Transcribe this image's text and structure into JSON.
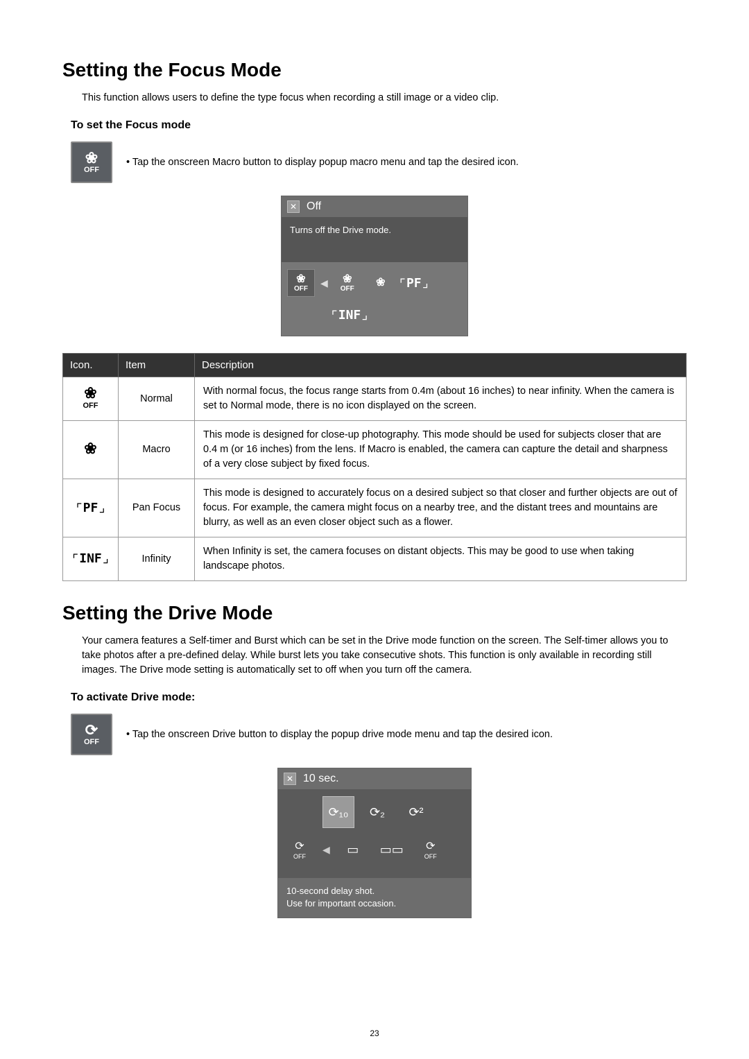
{
  "page_number": "23",
  "section1": {
    "heading": "Setting the Focus Mode",
    "intro": "This function allows users to define the type focus when recording a still image or a video clip.",
    "sub": "To set the Focus mode",
    "bullet": "Tap the onscreen Macro button to display popup macro menu and tap the desired icon.",
    "button_label": "OFF",
    "popup": {
      "title": "Off",
      "body": "Turns off the Drive mode.",
      "icons": [
        "OFF",
        "OFF",
        "",
        "PF",
        "INF"
      ]
    },
    "table": {
      "headers": [
        "Icon.",
        "Item",
        "Description"
      ],
      "rows": [
        {
          "icon": "flower-off",
          "item": "Normal",
          "desc": "With normal focus, the focus range starts from 0.4m (about 16 inches) to near infinity. When the camera is set to Normal mode, there is no icon displayed on the screen."
        },
        {
          "icon": "flower",
          "item": "Macro",
          "desc": "This mode is designed for close-up photography.  This mode should be used for subjects closer that are 0.4 m (or 16 inches) from the lens.  If Macro is enabled, the camera can capture the detail and sharpness of a very close subject by fixed focus."
        },
        {
          "icon": "pf",
          "item": "Pan Focus",
          "desc": "This mode is designed to accurately focus on a desired subject so that closer and further objects are out of focus. For example, the camera might focus on a nearby tree, and the distant trees and mountains are blurry, as well as an even closer object such as a flower."
        },
        {
          "icon": "inf",
          "item": "Infinity",
          "desc": "When Infinity is set, the camera focuses on distant objects. This may be good to use when taking landscape photos."
        }
      ]
    }
  },
  "section2": {
    "heading": "Setting the Drive Mode",
    "intro": "Your camera features a Self-timer and Burst which can be set in the Drive mode function on the screen. The Self-timer allows you to take photos after a pre-defined delay. While burst lets you take consecutive shots. This function is only available in recording still images. The Drive mode setting is automatically set to off when you turn off the camera.",
    "sub": "To activate Drive mode:",
    "bullet": "Tap the onscreen Drive button to display the popup drive mode menu and tap the desired icon.",
    "button_label": "OFF",
    "popup": {
      "title": "10 sec.",
      "desc1": "10-second delay shot.",
      "desc2": "Use for important occasion."
    }
  }
}
